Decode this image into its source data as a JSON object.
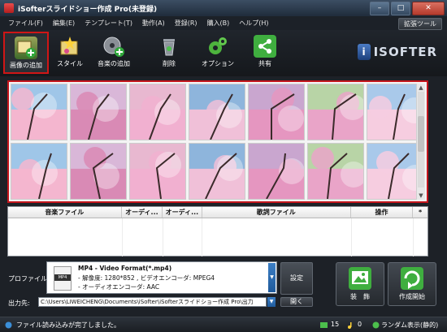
{
  "window": {
    "title": "iSofterスライドショー作成 Pro(未登録)",
    "minimize_label": "–",
    "maximize_label": "□",
    "close_label": "✕"
  },
  "menu": {
    "items": [
      "ファイル(F)",
      "編集(E)",
      "テンプレート(T)",
      "動作(A)",
      "登録(R)",
      "購入(B)",
      "ヘルプ(H)"
    ],
    "extension_button": "拡張ツール"
  },
  "toolbar": {
    "buttons": [
      {
        "label": "画像の追加",
        "icon": "add-image-icon"
      },
      {
        "label": "スタイル",
        "icon": "style-icon"
      },
      {
        "label": "音楽の追加",
        "icon": "add-music-icon"
      },
      {
        "label": "削除",
        "icon": "trash-icon"
      },
      {
        "label": "オプション",
        "icon": "gear-icon"
      },
      {
        "label": "共有",
        "icon": "share-icon"
      }
    ],
    "logo_text": "ISOFTER",
    "logo_mark": "i"
  },
  "thumbnails": {
    "count": 14,
    "scroll_up": "▲",
    "scroll_down": "▼"
  },
  "music_table": {
    "columns": [
      "音楽ファイル",
      "オーディ...",
      "オーディ...",
      "歌詞ファイル",
      "操作",
      "*"
    ],
    "rows": []
  },
  "output": {
    "profile_label": "プロファイル:",
    "profile_title": "MP4 - Video Format(*.mp4)",
    "profile_line1": "- 解像度: 1280*852 , ビデオエンコーダ: MPEG4",
    "profile_line2": "- オーディオエンコーダ: AAC",
    "profile_icon_text": "MP4",
    "settings_button": "設定",
    "path_label": "出力先:",
    "path_value": "C:\\Users\\LIWEICHENG\\Documents\\iSofter\\iSofterスライドショー作成 Pro\\出力",
    "open_button": "開く",
    "decorate_button": "装　飾",
    "start_button": "作成開始"
  },
  "status": {
    "message": "ファイル読み込みが完了しました。",
    "image_count": "15",
    "music_count": "0",
    "random_label": "ランダム表示(静的)"
  },
  "colors": {
    "highlight": "#c4151c",
    "background": "#1d2127",
    "accent_blue": "#1f5a9b"
  }
}
